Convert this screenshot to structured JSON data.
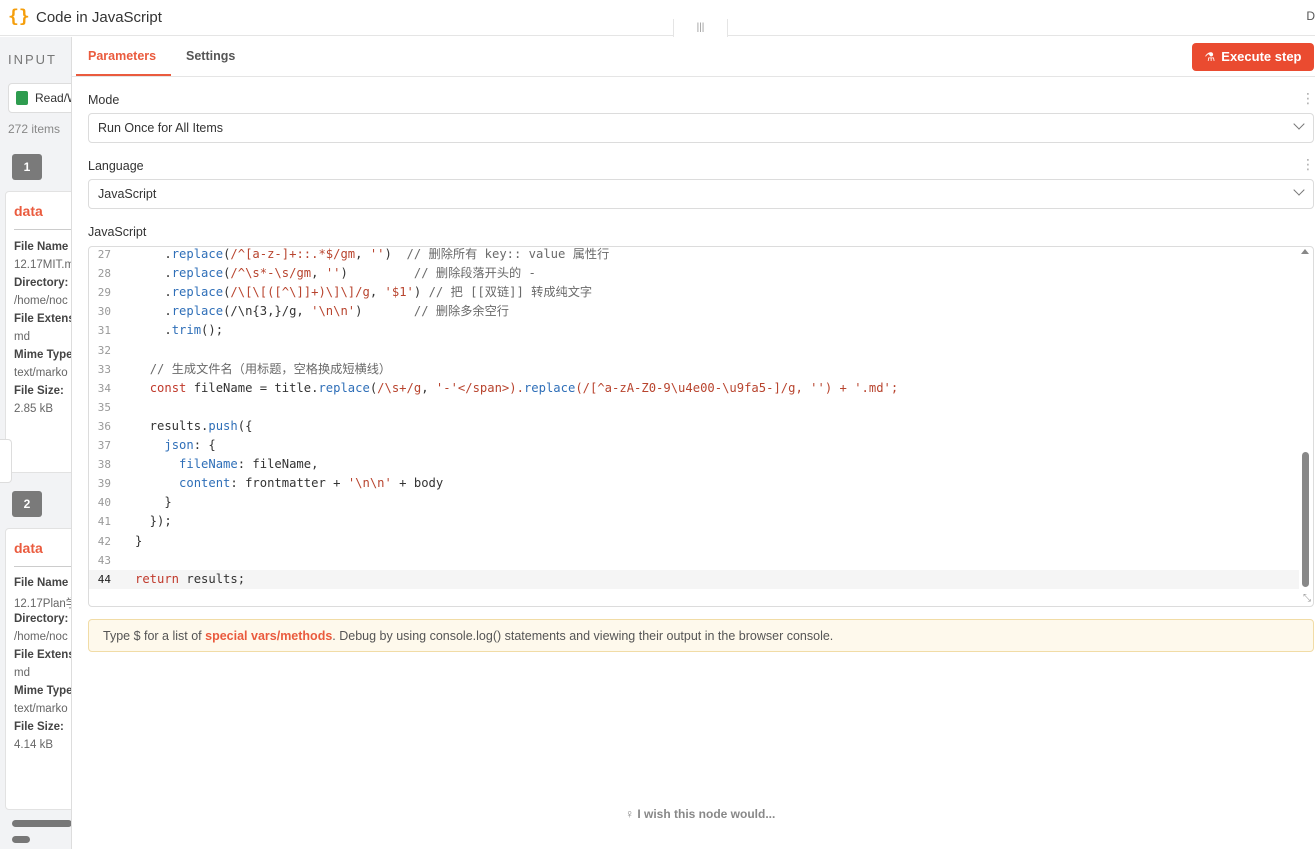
{
  "titlebar": {
    "logo": "{}",
    "title": "Code in JavaScript",
    "drag_handle": "|||",
    "close": "D"
  },
  "input_panel": {
    "header": "INPUT",
    "selector_label": "Read/W",
    "item_count": "272 items",
    "rows": [
      {
        "index": "1",
        "title": "data",
        "fields": [
          {
            "key": "File Name",
            "value": "12.17MIT.m"
          },
          {
            "key": "Directory:",
            "value": "/home/noc"
          },
          {
            "key": "File Extens",
            "value": "md"
          },
          {
            "key": "Mime Type",
            "value": "text/marko"
          },
          {
            "key": "File Size:",
            "value": "2.85 kB"
          }
        ]
      },
      {
        "index": "2",
        "title": "data",
        "fields": [
          {
            "key": "File Name",
            "value": "12.17Plan学"
          },
          {
            "key": "Directory:",
            "value": "/home/noc"
          },
          {
            "key": "File Extens",
            "value": "md"
          },
          {
            "key": "Mime Type",
            "value": "text/marko"
          },
          {
            "key": "File Size:",
            "value": "4.14 kB"
          }
        ]
      }
    ]
  },
  "tabs": {
    "parameters": "Parameters",
    "settings": "Settings"
  },
  "execute_button": {
    "icon": "flask-icon",
    "label": "Execute step"
  },
  "mode": {
    "label": "Mode",
    "value": "Run Once for All Items"
  },
  "language": {
    "label": "Language",
    "value": "JavaScript"
  },
  "editor": {
    "label": "JavaScript",
    "lines": [
      {
        "n": "27",
        "code": "    .replace(/^[a-z-]+::.*$/gm, '')  // 删除所有 key:: value 属性行"
      },
      {
        "n": "28",
        "code": "    .replace(/^\\s*-\\s/gm, '')         // 删除段落开头的 -"
      },
      {
        "n": "29",
        "code": "    .replace(/\\[\\[([^\\]]+)\\]\\]/g, '$1') // 把 [[双链]] 转成纯文字"
      },
      {
        "n": "30",
        "code": "    .replace(/\\n{3,}/g, '\\n\\n')       // 删除多余空行"
      },
      {
        "n": "31",
        "code": "    .trim();"
      },
      {
        "n": "32",
        "code": ""
      },
      {
        "n": "33",
        "code": "  // 生成文件名（用标题，空格换成短横线）"
      },
      {
        "n": "34",
        "code": "  const fileName = title.replace(/\\s+/g, '-').replace(/[^a-zA-Z0-9\\u4e00-\\u9fa5-]/g, '') + '.md';"
      },
      {
        "n": "35",
        "code": ""
      },
      {
        "n": "36",
        "code": "  results.push({"
      },
      {
        "n": "37",
        "code": "    json: {"
      },
      {
        "n": "38",
        "code": "      fileName: fileName,"
      },
      {
        "n": "39",
        "code": "      content: frontmatter + '\\n\\n' + body"
      },
      {
        "n": "40",
        "code": "    }"
      },
      {
        "n": "41",
        "code": "  });"
      },
      {
        "n": "42",
        "code": "}"
      },
      {
        "n": "43",
        "code": ""
      },
      {
        "n": "44",
        "code": "return results;"
      }
    ],
    "active_line": "44"
  },
  "hint": {
    "prefix": "Type $ for a list of ",
    "link": "special vars/methods",
    "suffix": ". Debug by using console.log() statements and viewing their output in the browser console."
  },
  "wish": "I wish this node would..."
}
